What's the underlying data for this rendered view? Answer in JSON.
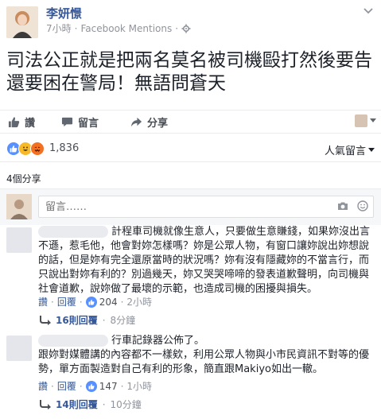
{
  "post": {
    "author": "李妍憬",
    "time": "7小時",
    "via": "Facebook Mentions",
    "text": "司法公正就是把兩名莫名被司機毆打然後要告還要困在警局！無語問蒼天"
  },
  "actions": {
    "like": "讚",
    "comment": "留言",
    "share": "分享"
  },
  "reactions": {
    "count": "1,836",
    "popular": "人氣留言",
    "colors": {
      "like": "#5890ff",
      "haha": "#f7b928",
      "halloween": "#f36f21"
    }
  },
  "shares": "4個分享",
  "composer": {
    "placeholder": "留言……"
  },
  "comments": [
    {
      "text": "計程車司機就像生意人，只要做生意賺錢，如果妳沒出言不遜，惹毛他，他會對妳怎樣嗎？妳是公眾人物，有窗口讓妳說出妳想說的話，但是妳有完全還原當時的狀況嗎？妳有沒有隱藏妳的不當言行，而只說出對妳有利的？別過幾天，妳又哭哭啼啼的發表道歉聲明，向司機與社會道歉，說妳做了最壞的示範，也造成司機的困擾與損失。",
      "like": "讚",
      "reply": "回覆",
      "likes": "204",
      "time": "2小時",
      "replies": "16則回覆",
      "replies_time": "8分鐘"
    },
    {
      "name_suffix": "行車記錄器公佈了。",
      "text": "跟妳對媒體講的內容都不一樣欸，利用公眾人物與小市民資訊不對等的優勢，單方面製造對自己有利的形象，簡直跟Makiyo如出一轍。",
      "like": "讚",
      "reply": "回覆",
      "likes": "147",
      "time": "1小時",
      "replies": "14則回覆",
      "replies_time": "10分鐘"
    }
  ]
}
